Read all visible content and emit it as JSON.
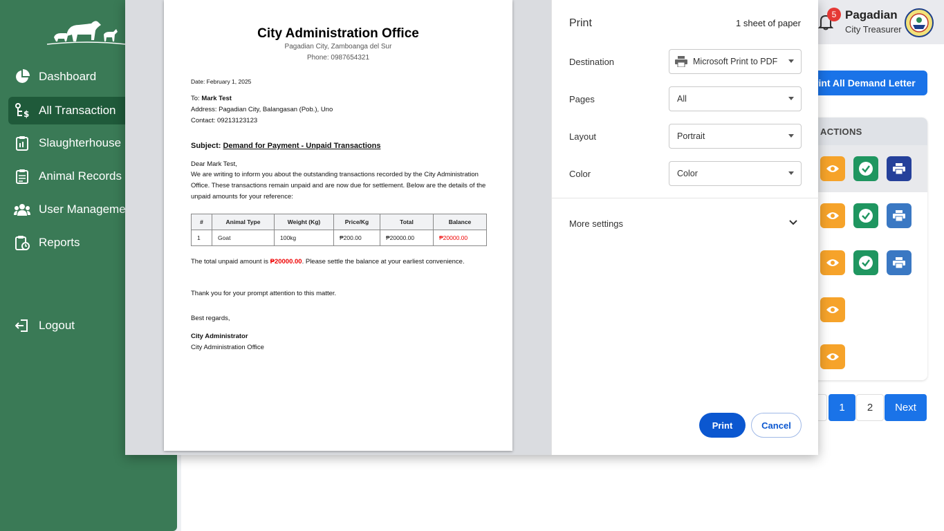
{
  "sidebar": {
    "items": [
      {
        "label": "Dashboard",
        "icon": "pie-chart-icon"
      },
      {
        "label": "All Transaction",
        "icon": "transaction-icon"
      },
      {
        "label": "Slaughterhouse R",
        "icon": "clipboard-icon"
      },
      {
        "label": "Animal Records",
        "icon": "records-icon"
      },
      {
        "label": "User Managemen",
        "icon": "users-icon"
      },
      {
        "label": "Reports",
        "icon": "report-icon"
      }
    ],
    "logout": "Logout"
  },
  "header": {
    "notification_count": "5",
    "user_name": "Pagadian",
    "user_role": "City Treasurer"
  },
  "main": {
    "print_all_label": "rint All Demand Letter",
    "actions_header": "ACTIONS",
    "pagination": {
      "page1": "1",
      "page2": "2",
      "next": "Next"
    }
  },
  "document": {
    "title": "City Administration Office",
    "address": "Pagadian City, Zamboanga del Sur",
    "phone": "Phone: 0987654321",
    "date": "Date: February 1, 2025",
    "to_prefix": "To: ",
    "to_name": "Mark Test",
    "recipient_address": "Address: Pagadian City, Balangasan (Pob.), Uno",
    "contact": "Contact: 09213123123",
    "subject_prefix": "Subject: ",
    "subject": "Demand for Payment - Unpaid Transactions",
    "greeting": "Dear Mark Test,",
    "body": "We are writing to inform you about the outstanding transactions recorded by the City Administration Office. These transactions remain unpaid and are now due for settlement. Below are the details of the unpaid amounts for your reference:",
    "table": {
      "headers": [
        "#",
        "Animal Type",
        "Weight (Kg)",
        "Price/Kg",
        "Total",
        "Balance"
      ],
      "rows": [
        [
          "1",
          "Goat",
          "100kg",
          "₱200.00",
          "₱20000.00",
          "₱20000.00"
        ]
      ]
    },
    "total_prefix": "The total unpaid amount is ",
    "total_amount": "₱20000.00",
    "total_suffix": ". Please settle the balance at your earliest convenience.",
    "thanks": "Thank you for your prompt attention to this matter.",
    "closing": "Best regards,",
    "signatory": "City Administrator",
    "signatory_office": "City Administration Office"
  },
  "print_settings": {
    "title": "Print",
    "sheets": "1 sheet of paper",
    "destination_label": "Destination",
    "destination_value": "Microsoft Print to PDF",
    "pages_label": "Pages",
    "pages_value": "All",
    "layout_label": "Layout",
    "layout_value": "Portrait",
    "color_label": "Color",
    "color_value": "Color",
    "more_settings": "More settings",
    "print_button": "Print",
    "cancel_button": "Cancel"
  },
  "colors": {
    "sidebar": "#3a7a56",
    "sidebar_active": "#1f5a3a",
    "primary": "#1a73e8",
    "print_primary": "#0b57d0",
    "view": "#f6a32a",
    "approve": "#1f9660",
    "print_action": "#3a78c3",
    "balance_red": "#e00000"
  }
}
